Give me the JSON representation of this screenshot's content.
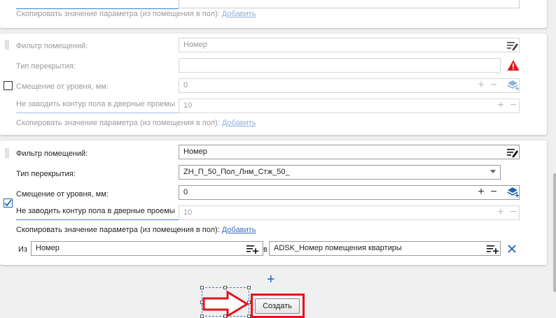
{
  "card_top": {
    "copy_text": "Скопировать значение параметра (из помещения в пол):",
    "copy_link": "Добавить"
  },
  "card_mid": {
    "filter_label": "Фильтр помещений:",
    "filter_value": "Номер",
    "type_label": "Тип перекрытия:",
    "type_value": "",
    "offset_label": "Смещение от уровня, мм:",
    "offset_value": "0",
    "door_label": "Не заводить контур пола в дверные проемы",
    "door_value": "10",
    "copy_text": "Скопировать значение параметра (из помещения в пол):",
    "copy_link": "Добавить",
    "offset_checked": false,
    "warning_color": "#e0141c"
  },
  "card_bottom": {
    "filter_label": "Фильтр помещений:",
    "filter_value": "Номер",
    "type_label": "Тип перекрытия:",
    "type_value": "ZH_П_50_Пол_Лнм_Стж_50_",
    "offset_label": "Смещение от уровня, мм:",
    "offset_value": "0",
    "door_label": "Не заводить контур пола в дверные проемы",
    "door_value": "10",
    "copy_text": "Скопировать значение параметра (из помещения в пол):",
    "copy_link": "Добавить",
    "offset_checked": true,
    "mapping": {
      "from_label": "Из",
      "from_value": "Номер",
      "to_label": "в",
      "to_value": "ADSK_Номер помещения квартиры"
    }
  },
  "actions": {
    "add_symbol": "+",
    "create_label": "Создать",
    "accent_color": "#1e64b4",
    "highlight_color": "#e0141c"
  },
  "icons": [
    "list-edit-icon",
    "warning-icon",
    "layers-add-icon",
    "list-add-icon",
    "close-icon",
    "plus-icon",
    "arrow-right-icon",
    "chevron-down-icon"
  ]
}
